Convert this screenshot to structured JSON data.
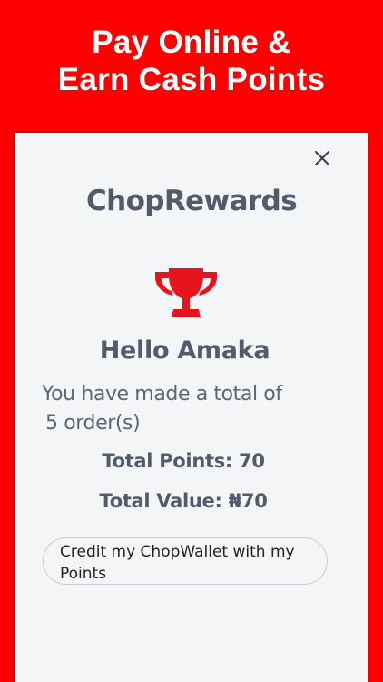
{
  "promo": {
    "line1": "Pay Online &",
    "line2": "Earn Cash Points"
  },
  "dialog": {
    "close_icon": "close-icon",
    "brand": "ChopRewards",
    "trophy_icon": "trophy-icon",
    "greeting": "Hello Amaka",
    "orders_line1": "You have made a total of",
    "orders_line2": "5 order(s)",
    "total_points": "Total Points: 70",
    "total_value": "Total Value: ₦70",
    "credit_button": "Credit my ChopWallet with my Points"
  },
  "colors": {
    "background": "#ff0000",
    "card": "#f4f5f7",
    "text": "#525b6c",
    "trophy": "#e8141c"
  }
}
